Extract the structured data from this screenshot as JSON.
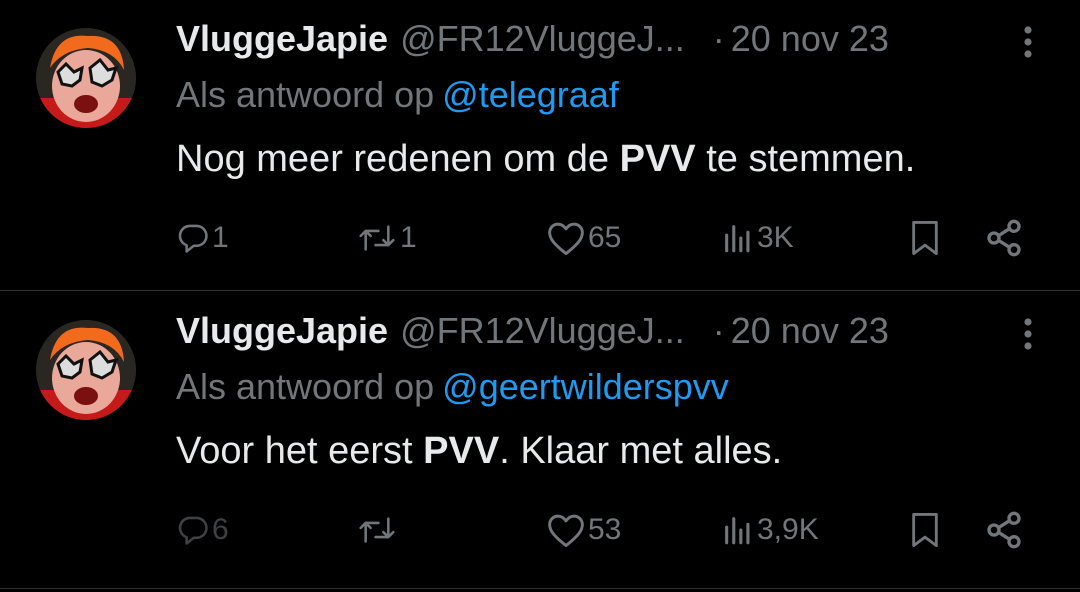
{
  "tweets": [
    {
      "author_name": "VluggeJapie",
      "handle": "@FR12VluggeJ...",
      "separator": "·",
      "date": "20 nov 23",
      "reply_prefix": "Als antwoord op",
      "reply_mention": "@telegraaf",
      "text_before": "Nog meer redenen om de ",
      "text_bold": "PVV",
      "text_after": " te stemmen.",
      "reply_count": "1",
      "retweet_count": "1",
      "like_count": "65",
      "view_count": "3K"
    },
    {
      "author_name": "VluggeJapie",
      "handle": "@FR12VluggeJ...",
      "separator": "·",
      "date": "20 nov 23",
      "reply_prefix": "Als antwoord op",
      "reply_mention": "@geertwilderspvv",
      "text_before": "Voor het eerst ",
      "text_bold": "PVV",
      "text_after": ". Klaar met alles.",
      "reply_count": "6",
      "retweet_count": "",
      "like_count": "53",
      "view_count": "3,9K"
    }
  ],
  "colors": {
    "background": "#000000",
    "text_primary": "#e7e9ea",
    "text_secondary": "#71767b",
    "mention": "#1d9bf0",
    "divider": "#2f3336"
  }
}
